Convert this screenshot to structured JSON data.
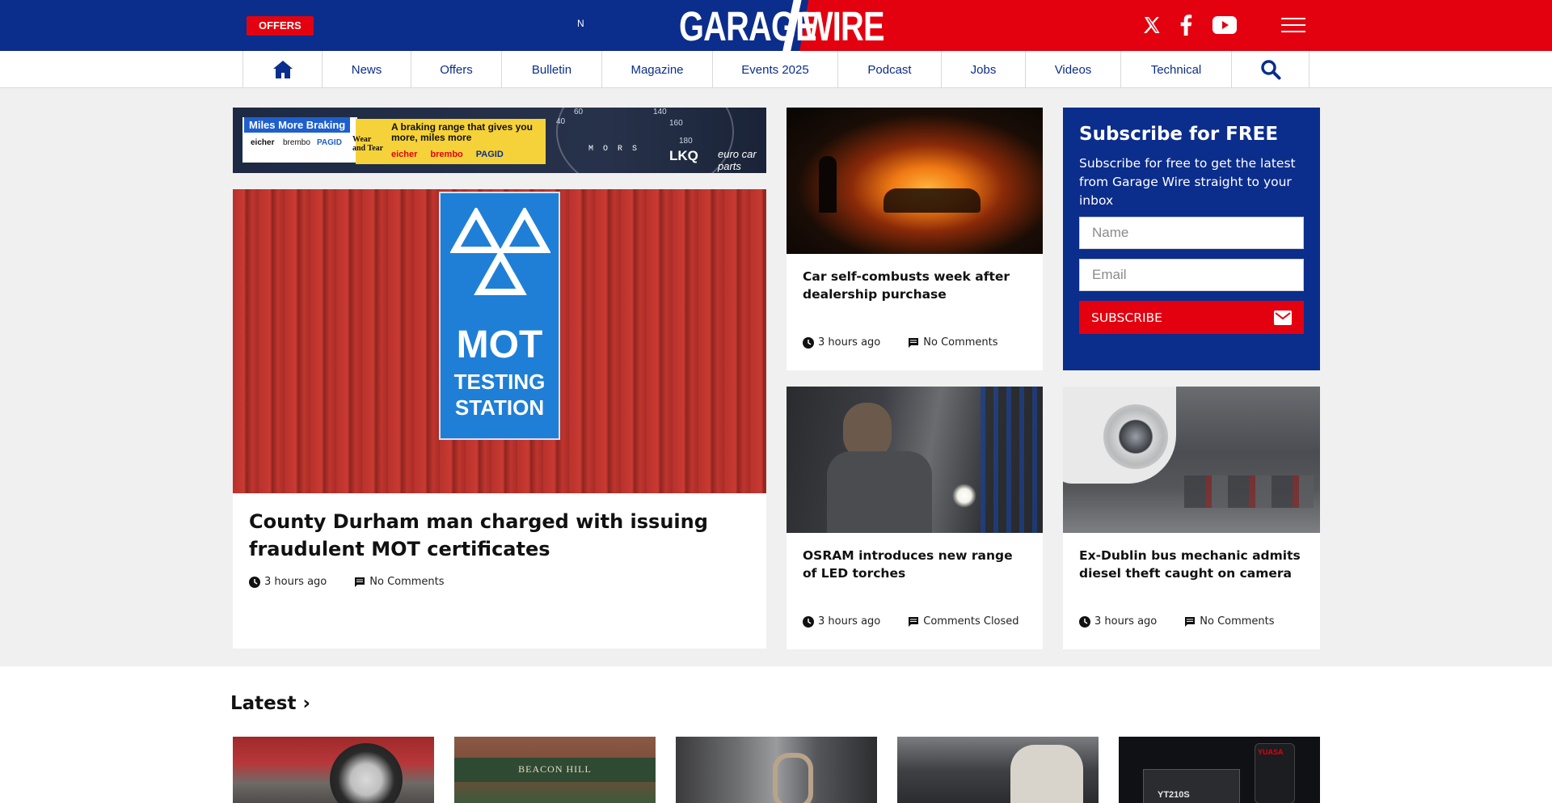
{
  "topbar": {
    "offers_label": "OFFERS",
    "ticker_text": "N",
    "logo_left": "GARAGE",
    "logo_right": "WIRE",
    "social": [
      {
        "name": "x-icon"
      },
      {
        "name": "facebook-icon"
      },
      {
        "name": "youtube-icon"
      }
    ],
    "menu_icon": "hamburger-menu-icon",
    "colors": {
      "blue": "#0b2d8c",
      "red": "#e3000f"
    }
  },
  "nav": {
    "items": [
      {
        "label": "News"
      },
      {
        "label": "Offers"
      },
      {
        "label": "Bulletin"
      },
      {
        "label": "Magazine"
      },
      {
        "label": "Events 2025"
      },
      {
        "label": "Podcast"
      },
      {
        "label": "Jobs"
      },
      {
        "label": "Videos"
      },
      {
        "label": "Technical"
      }
    ],
    "home_icon": "home-icon",
    "search_icon": "search-icon"
  },
  "ad": {
    "tag": "Miles More Braking",
    "text": "A braking range that gives you more, miles more",
    "wear_tear": "Wear and Tear",
    "brands": [
      "eicher",
      "brembo",
      "PAGID"
    ],
    "dial_numbers": [
      "40",
      "60",
      "140",
      "160",
      "180"
    ],
    "lkq": "LKQ",
    "euro": "euro car parts",
    "gear": "M O R S"
  },
  "featured": {
    "sign_line1": "MOT",
    "sign_line2": "TESTING",
    "sign_line3": "STATION",
    "title": "County Durham man charged with issuing fraudulent MOT certificates",
    "time": "3 hours ago",
    "comments": "No Comments"
  },
  "stories": [
    {
      "title": "Car self-combusts week after dealership purchase",
      "time": "3 hours ago",
      "comments": "No Comments"
    },
    {
      "title": "OSRAM introduces new range of LED torches",
      "time": "3 hours ago",
      "comments": "Comments Closed"
    },
    {
      "title": "Ex-Dublin bus mechanic admits diesel theft caught on camera",
      "time": "3 hours ago",
      "comments": "No Comments"
    }
  ],
  "subscribe": {
    "title": "Subscribe for FREE",
    "text": "Subscribe for free to get the latest from Garage Wire straight to your inbox",
    "name_placeholder": "Name",
    "email_placeholder": "Email",
    "button_label": "SUBSCRIBE",
    "button_icon": "mail-icon"
  },
  "latest": {
    "title": "Latest ›",
    "store_sign": "BEACON HILL",
    "battery_brand": "YUASA",
    "battery_code": "YT210S"
  }
}
